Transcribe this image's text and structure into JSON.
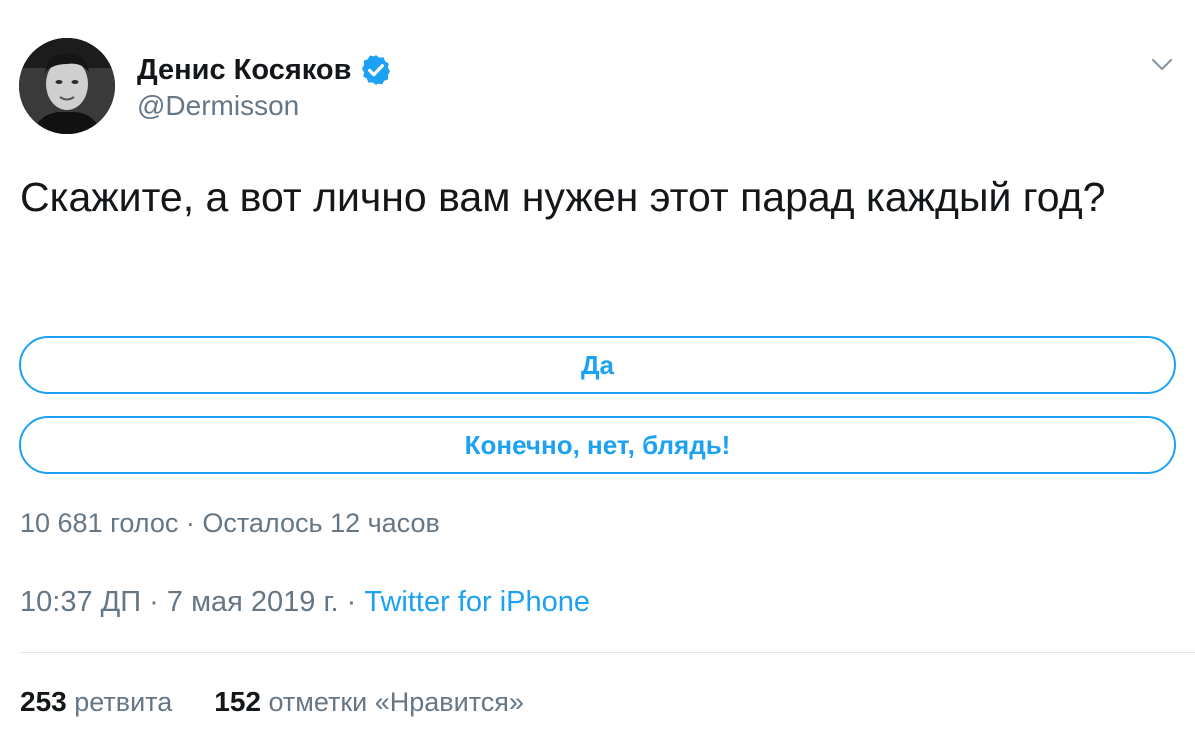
{
  "author": {
    "name": "Денис Косяков",
    "handle": "@Dermisson",
    "verified": true,
    "avatar_icon": "profile-photo"
  },
  "tweet": {
    "text": "Скажите, а вот лично вам нужен этот парад каждый год?"
  },
  "poll": {
    "options": [
      {
        "label": "Да"
      },
      {
        "label": "Конечно, нет, блядь!"
      }
    ],
    "votes": "10 681 голос",
    "separator": " · ",
    "time_left": "Осталось 12 часов"
  },
  "meta": {
    "time": "10:37 ДП",
    "date": "7 мая 2019 г.",
    "separator": " · ",
    "source": "Twitter for iPhone"
  },
  "stats": {
    "retweets_count": "253",
    "retweets_label": "ретвита",
    "likes_count": "152",
    "likes_label": "отметки «Нравится»"
  },
  "colors": {
    "accent": "#1da1f2",
    "secondary_text": "#657786",
    "primary_text": "#14171a",
    "divider": "#e1e8ed"
  },
  "icons": {
    "verified": "verified-badge-icon",
    "menu": "chevron-down-icon"
  }
}
